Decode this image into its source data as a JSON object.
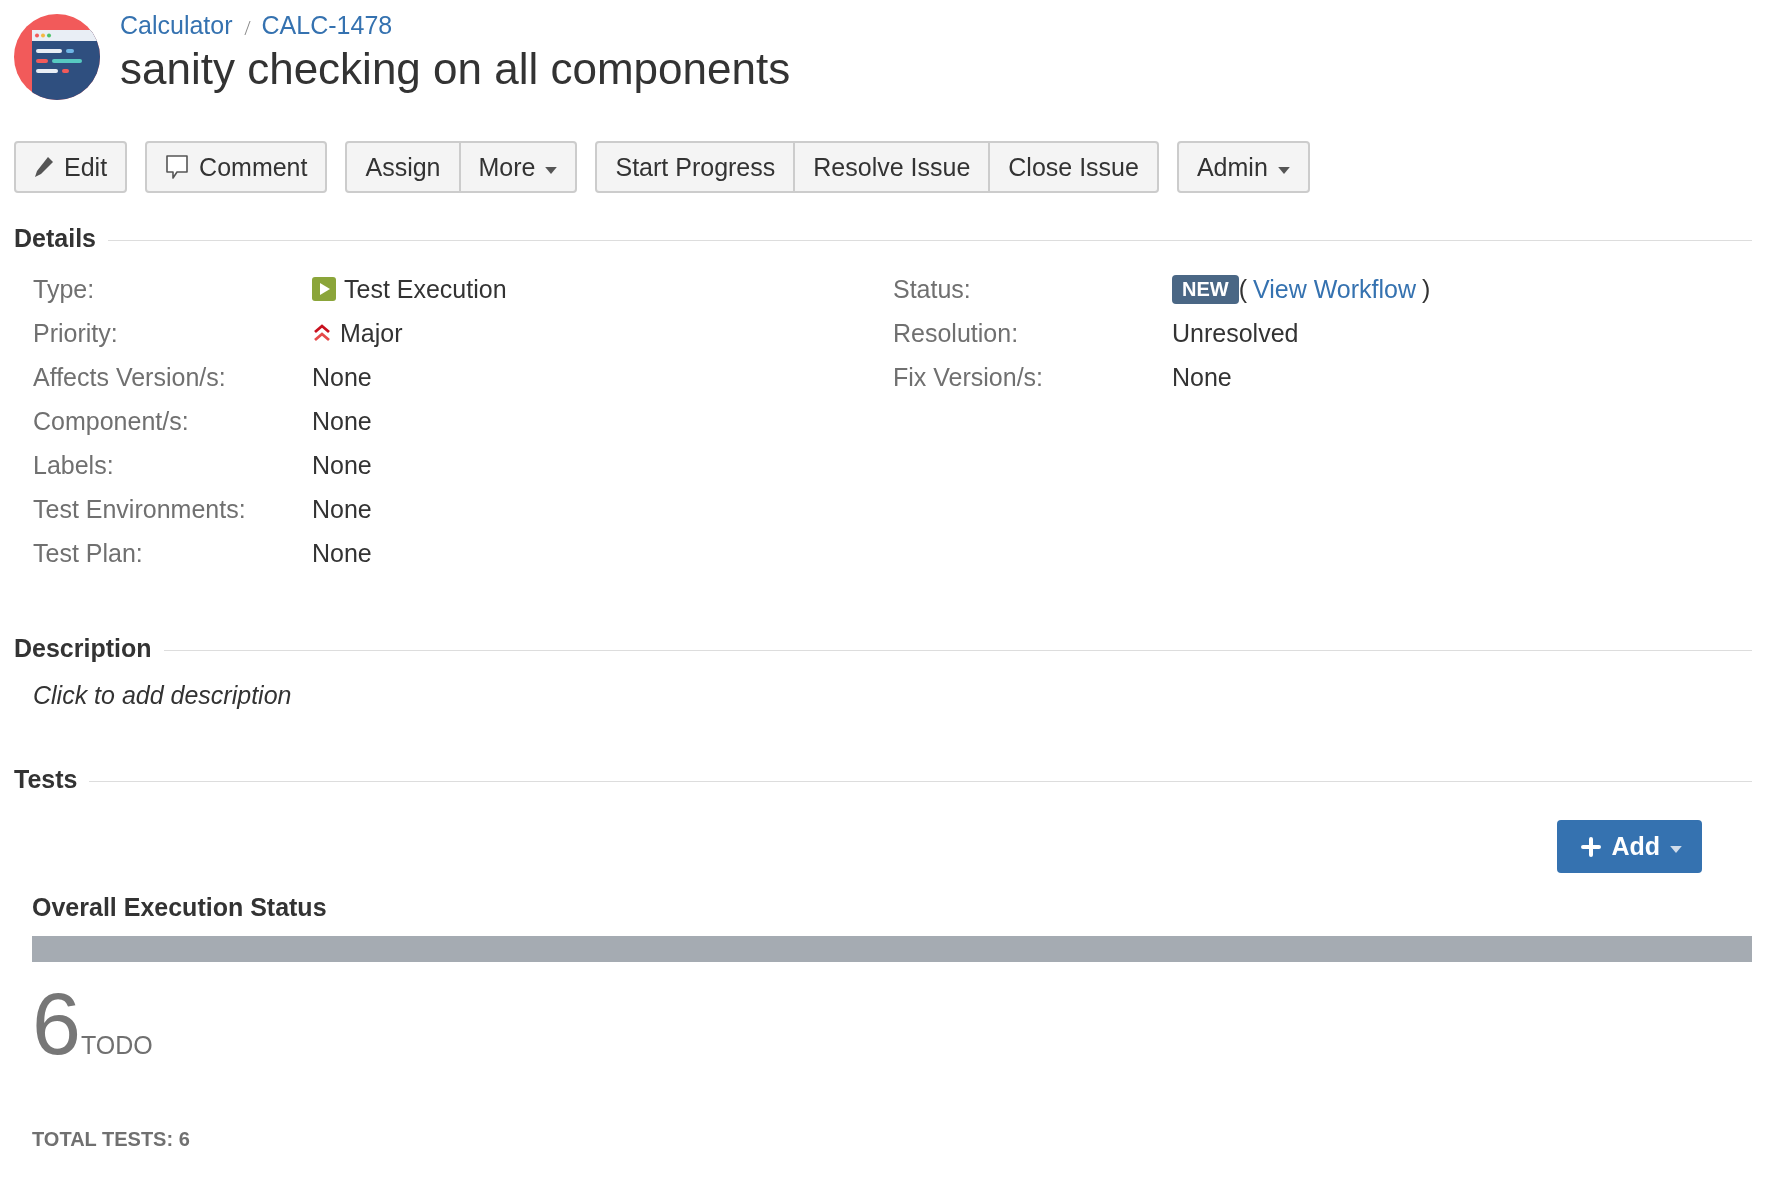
{
  "breadcrumbs": [
    "Calculator",
    "CALC-1478"
  ],
  "title": "sanity checking on all components",
  "toolbar": [
    [
      {
        "label": "Edit",
        "kind": "edit",
        "dropdown": false
      }
    ],
    [
      {
        "label": "Comment",
        "kind": "comment",
        "dropdown": false
      }
    ],
    [
      {
        "label": "Assign",
        "kind": "plain",
        "dropdown": false
      },
      {
        "label": "More",
        "kind": "plain",
        "dropdown": true
      }
    ],
    [
      {
        "label": "Start Progress",
        "kind": "plain",
        "dropdown": false
      },
      {
        "label": "Resolve Issue",
        "kind": "plain",
        "dropdown": false
      },
      {
        "label": "Close Issue",
        "kind": "plain",
        "dropdown": false
      }
    ],
    [
      {
        "label": "Admin",
        "kind": "plain",
        "dropdown": true
      }
    ]
  ],
  "details": {
    "heading": "Details",
    "left": [
      {
        "label": "Type:",
        "value": "Test Execution",
        "kind": "type"
      },
      {
        "label": "Priority:",
        "value": "Major",
        "kind": "priority"
      },
      {
        "label": "Affects Version/s:",
        "value": "None",
        "kind": "text"
      },
      {
        "label": "Component/s:",
        "value": "None",
        "kind": "text"
      },
      {
        "label": "Labels:",
        "value": "None",
        "kind": "text"
      },
      {
        "label": "Test Environments:",
        "value": "None",
        "kind": "text"
      },
      {
        "label": "Test Plan:",
        "value": "None",
        "kind": "text"
      }
    ],
    "right": [
      {
        "label": "Status:",
        "value": "NEW",
        "link_open": "(",
        "link": "View Workflow",
        "link_close": ")",
        "kind": "status"
      },
      {
        "label": "Resolution:",
        "value": "Unresolved",
        "kind": "text"
      },
      {
        "label": "Fix Version/s:",
        "value": "None",
        "kind": "text"
      }
    ]
  },
  "description": {
    "heading": "Description",
    "placeholder": "Click to add description"
  },
  "tests": {
    "heading": "Tests",
    "add_button": "Add",
    "status_heading": "Overall Execution Status",
    "bar": [
      {
        "level": 1,
        "color": "#a5abb2"
      }
    ],
    "count": "6",
    "count_label": "TODO",
    "total": "TOTAL TESTS: 6"
  }
}
